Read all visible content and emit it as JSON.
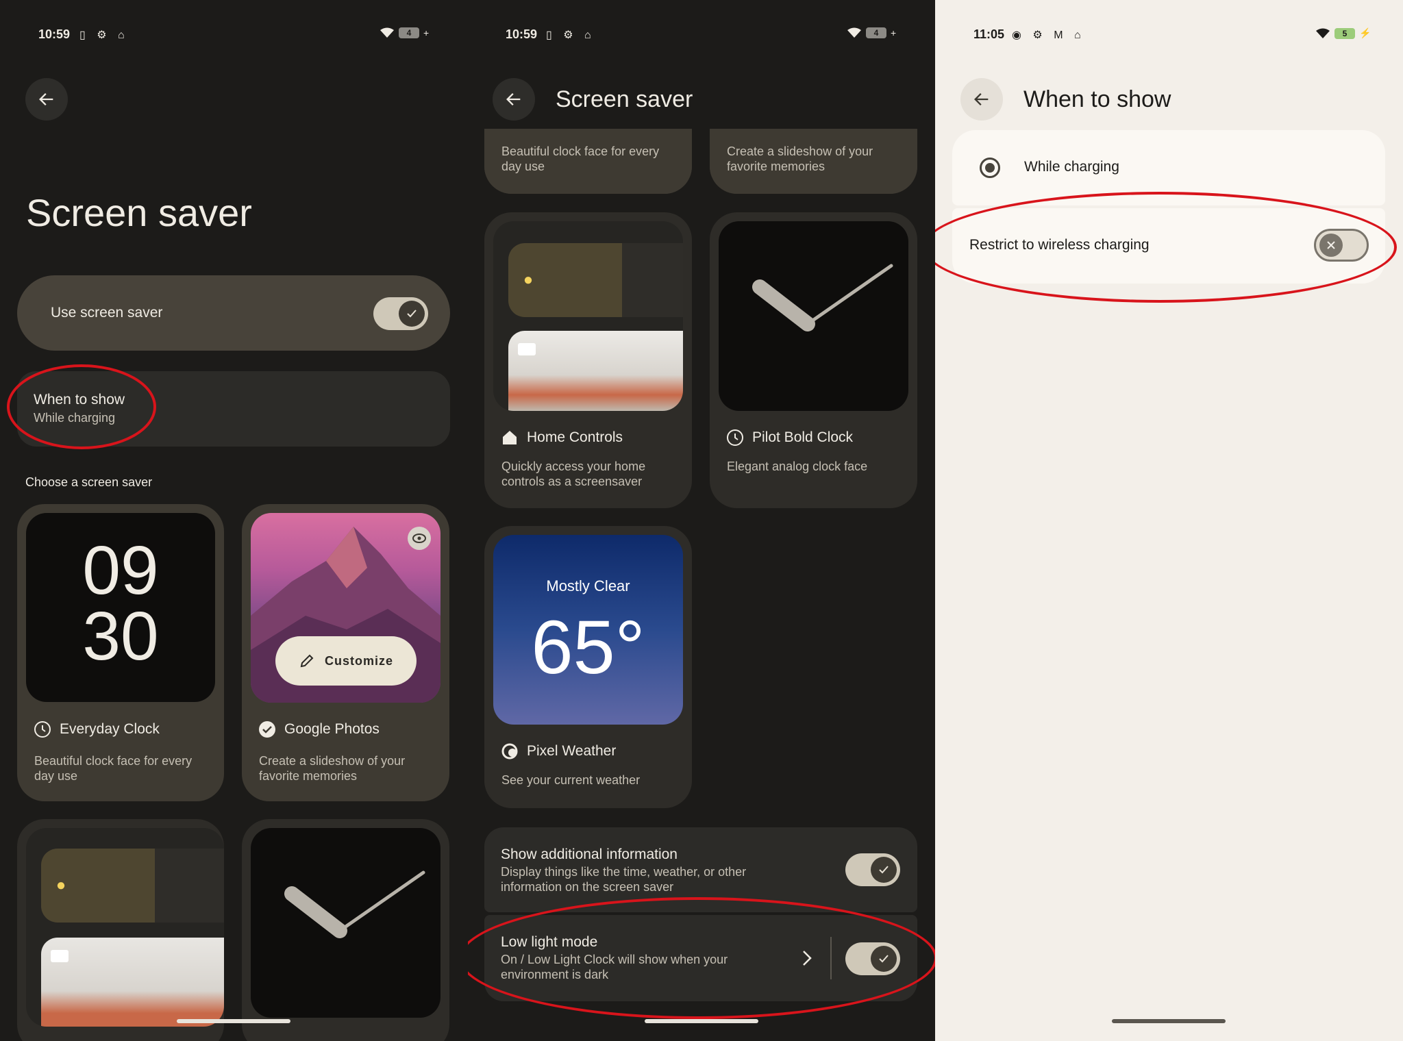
{
  "panel1": {
    "status": {
      "time": "10:59",
      "battery": "4",
      "left_icons": "▯ ⚙ ⌂"
    },
    "title": "Screen saver",
    "use_saver_label": "Use screen saver",
    "when_title": "When to show",
    "when_sub": "While charging",
    "choose_label": "Choose a screen saver",
    "clock_digits_top": "09",
    "clock_digits_bottom": "30",
    "everyday_title": "Everyday Clock",
    "everyday_desc": "Beautiful clock face for every day use",
    "photos_title": "Google Photos",
    "photos_desc": "Create a slideshow of your favorite memories",
    "customize_label": "Customize"
  },
  "panel2": {
    "status": {
      "time": "10:59",
      "battery": "4",
      "left_icons": "▯ ⚙ ⌂"
    },
    "title": "Screen saver",
    "top_left_desc": "Beautiful clock face for every day use",
    "top_right_desc": "Create a slideshow of your favorite memories",
    "home_title": "Home Controls",
    "home_desc": "Quickly access your home controls as a screensaver",
    "pilot_title": "Pilot Bold Clock",
    "pilot_desc": "Elegant analog clock face",
    "weather_condition": "Mostly Clear",
    "weather_temp": "65°",
    "weather_title": "Pixel Weather",
    "weather_desc": "See your current weather",
    "additional_title": "Show additional information",
    "additional_desc": "Display things like the time, weather, or other information on the screen saver",
    "lowlight_title": "Low light mode",
    "lowlight_desc": "On / Low Light Clock will show when your environment is dark"
  },
  "panel3": {
    "status": {
      "time": "11:05",
      "battery": "5",
      "left_icons": "◉ ⚙ M ⌂"
    },
    "title": "When to show",
    "option_label": "While charging",
    "restrict_label": "Restrict to wireless charging"
  },
  "icons": [
    "back-arrow-icon",
    "wifi-icon",
    "battery-icon",
    "check-icon",
    "clock-icon",
    "checkcircle-icon",
    "eye-icon",
    "pencil-icon",
    "home-icon",
    "lightbulb-icon",
    "camera-icon",
    "weather-icon",
    "chevron-right-icon",
    "radio-icon",
    "close-icon"
  ],
  "colors": {
    "annotation": "#d8141b",
    "accent_toggle": "#cfc8b8",
    "panel_dark": "#1c1b19",
    "panel_light": "#f3efe9"
  }
}
